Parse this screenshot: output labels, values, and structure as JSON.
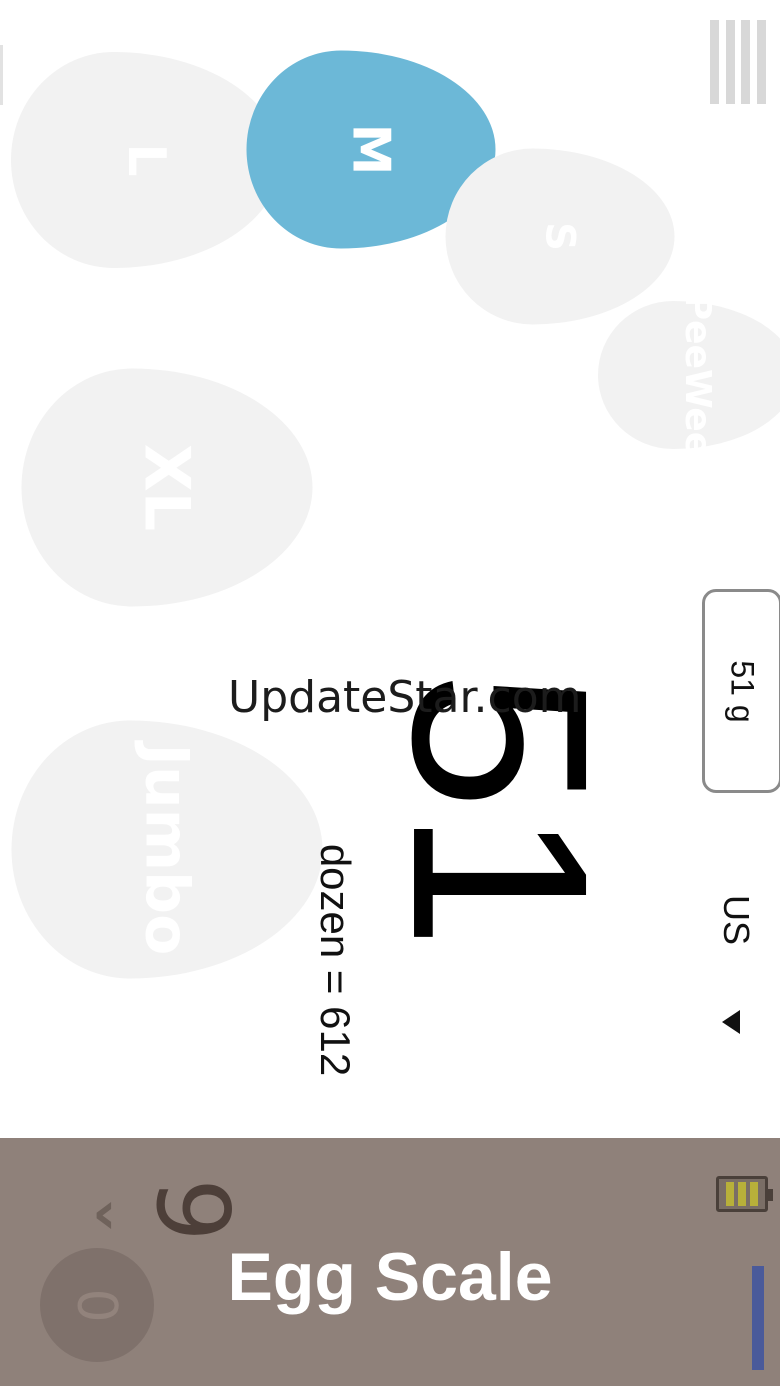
{
  "app": {
    "title": "Egg Scale"
  },
  "eggs": [
    {
      "id": "l",
      "label": "L",
      "selected": false
    },
    {
      "id": "m",
      "label": "M",
      "selected": true
    },
    {
      "id": "s",
      "label": "S",
      "selected": false
    },
    {
      "id": "peewee",
      "label": "PeeWee",
      "selected": false
    },
    {
      "id": "xl",
      "label": "XL",
      "selected": false
    },
    {
      "id": "jumbo",
      "label": "Jumbo",
      "selected": false
    }
  ],
  "display": {
    "weight": "51",
    "unit_weight": "51 g",
    "dozen_text": "dozen = 612",
    "region": "US"
  },
  "footer": {
    "count": "9",
    "back_glyph": "‹",
    "tare_label": "0"
  },
  "watermark": "UpdateStar.com",
  "icons": {
    "menu": "menu-icon",
    "battery": "battery-icon",
    "region_dropdown": "triangle-left-icon",
    "back": "chevron-left-icon"
  },
  "colors": {
    "accent": "#6cb8d7",
    "egg_inactive": "#f2f2f2",
    "footer_bg": "#8f817a",
    "battery_fill": "#b8b03a",
    "level_bar": "#4a5a9a"
  }
}
